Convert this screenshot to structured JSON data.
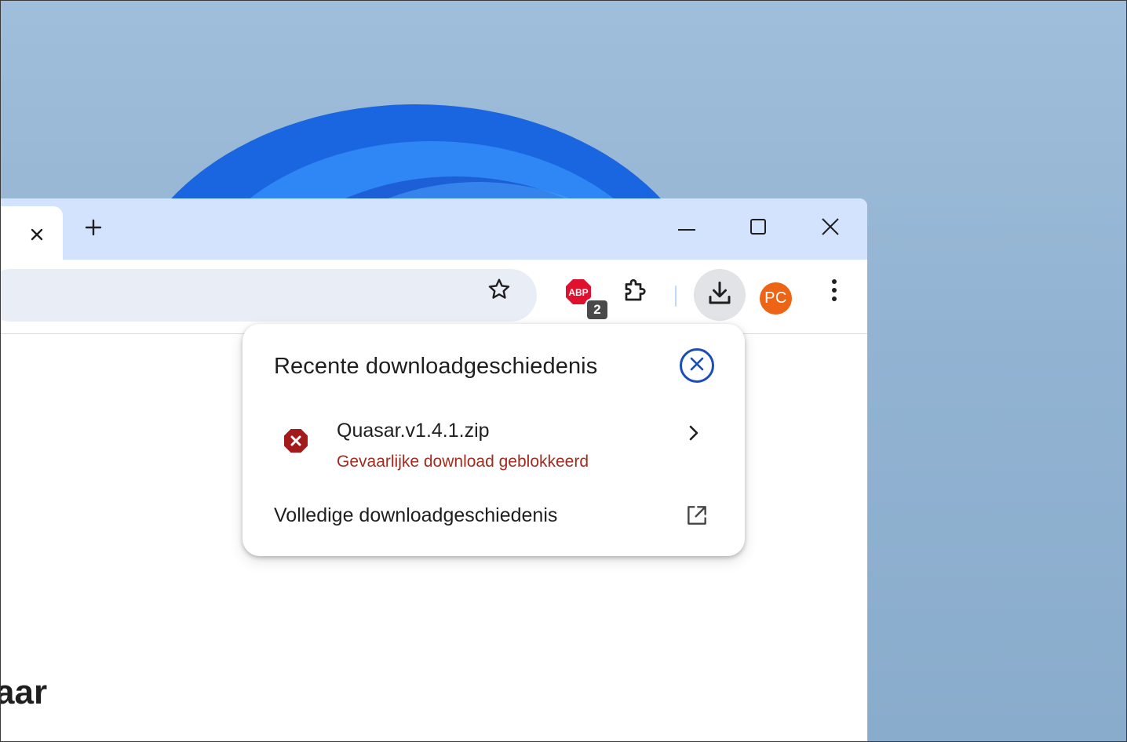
{
  "window": {
    "controls": {
      "minimize_icon": "minimize-icon",
      "maximize_icon": "maximize-icon",
      "close_icon": "close-icon"
    }
  },
  "tabs": {
    "active_tab_close_icon": "close-icon",
    "new_tab_icon": "plus-icon"
  },
  "toolbar": {
    "bookmark_icon": "star-icon",
    "adblock": {
      "icon": "adblock-plus-icon",
      "badge": "2"
    },
    "extensions_icon": "puzzle-icon",
    "downloads_icon": "download-icon",
    "profile": {
      "initials": "PC",
      "color": "#ed6416"
    },
    "menu_icon": "more-vert-icon"
  },
  "page": {
    "heading_fragment": "aar"
  },
  "downloads_popup": {
    "title": "Recente downloadgeschiedenis",
    "close_icon": "circle-close-icon",
    "items": [
      {
        "filename": "Quasar.v1.4.1.zip",
        "status": "Gevaarlijke download geblokkeerd",
        "status_color": "#a32a1e",
        "icon": "blocked-download-icon"
      }
    ],
    "full_history_label": "Volledige downloadgeschiedenis",
    "full_history_icon": "open-in-new-icon"
  },
  "colors": {
    "tabstrip": "#d3e3fd",
    "omnibox": "#e9eef6",
    "accent_blue": "#1a4dbb",
    "danger_red": "#a32a1e"
  }
}
